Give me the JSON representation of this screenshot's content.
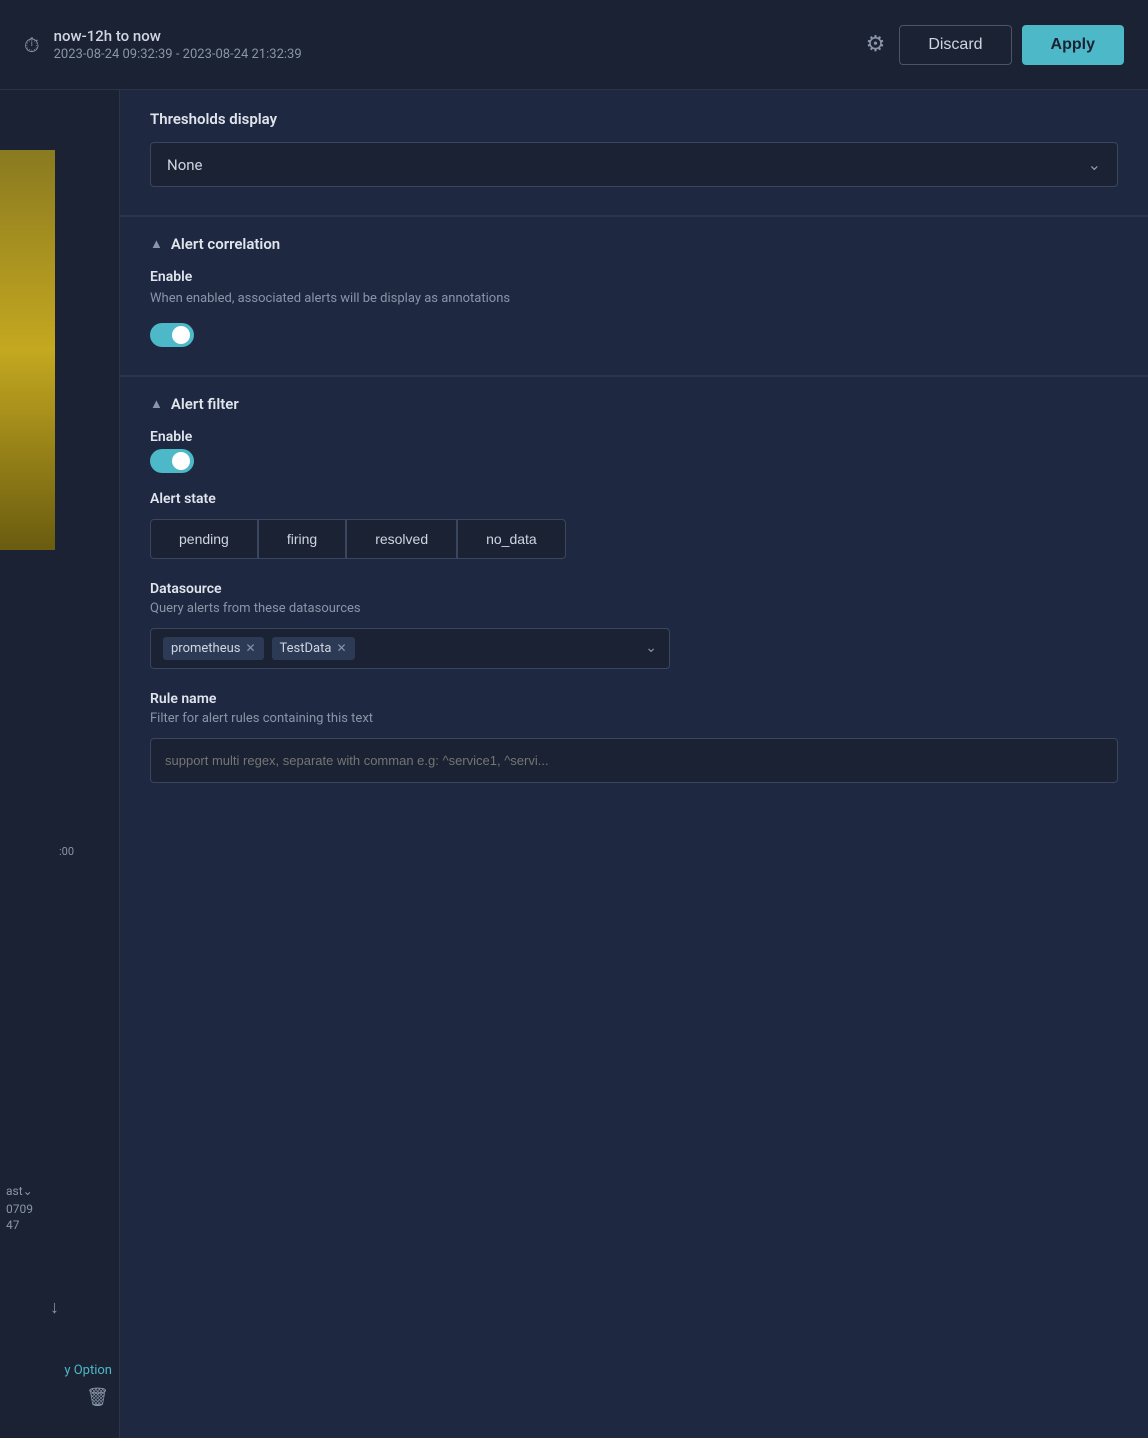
{
  "header": {
    "time_range_label": "now-12h to now",
    "time_range_dates": "2023-08-24 09:32:39 - 2023-08-24 21:32:39",
    "discard_label": "Discard",
    "apply_label": "Apply"
  },
  "left_panel": {
    "label_00": ":00",
    "label_ast": "ast⌄",
    "label_num1": "0709",
    "label_num2": "47",
    "y_option": "y Option"
  },
  "thresholds_section": {
    "title": "Thresholds display",
    "dropdown_value": "None"
  },
  "alert_correlation": {
    "section_title": "Alert correlation",
    "enable_label": "Enable",
    "enable_description": "When enabled, associated alerts will be display as annotations"
  },
  "alert_filter": {
    "section_title": "Alert filter",
    "enable_label": "Enable",
    "alert_state_label": "Alert state",
    "state_buttons": [
      "pending",
      "firing",
      "resolved",
      "no_data"
    ],
    "datasource_label": "Datasource",
    "datasource_description": "Query alerts from these datasources",
    "datasource_tags": [
      "prometheus",
      "TestData"
    ],
    "rule_name_label": "Rule name",
    "rule_name_description": "Filter for alert rules containing this text",
    "rule_name_placeholder": "support multi regex, separate with comman e.g: ^service1, ^servi..."
  }
}
